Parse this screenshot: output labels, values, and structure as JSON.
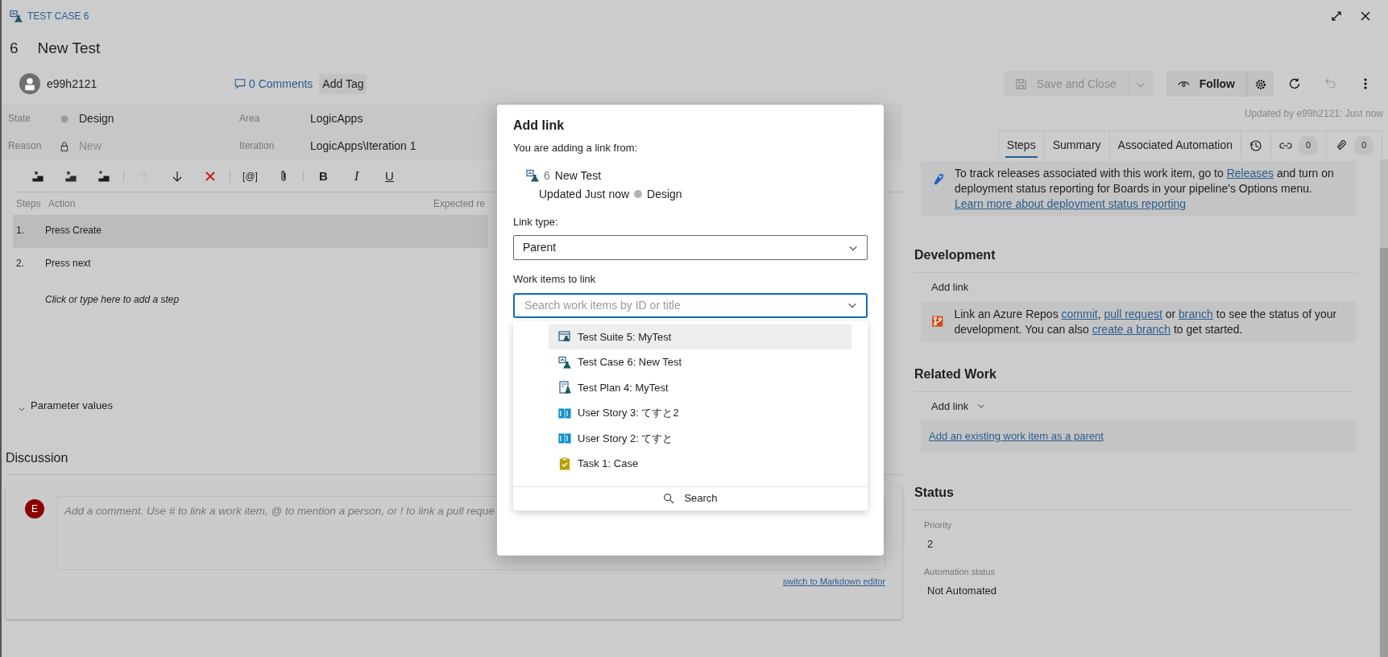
{
  "window": {
    "kind_label": "TEST CASE 6",
    "id": "6",
    "title": "New Test"
  },
  "header": {
    "assigned_to": "e99h2121",
    "comments": "0 Comments",
    "add_tag": "Add Tag",
    "updated": "Updated by e99h2121: Just now"
  },
  "toolbar": {
    "save": "Save and Close",
    "save_disabled": true,
    "follow": "Follow"
  },
  "fields": [
    {
      "label": "State",
      "value": "Design",
      "kind": "state"
    },
    {
      "label": "Area",
      "value": "LogicApps",
      "kind": "plain"
    },
    {
      "label": "Reason",
      "value": "New",
      "kind": "locked"
    },
    {
      "label": "Iteration",
      "value": "LogicApps\\Iteration 1",
      "kind": "plain"
    }
  ],
  "tabs": [
    {
      "label": "Steps",
      "selected": true
    },
    {
      "label": "Summary",
      "selected": false
    },
    {
      "label": "Associated Automation",
      "selected": false
    }
  ],
  "icon_tabs": [
    {
      "kind": "history"
    },
    {
      "kind": "links",
      "count": "0"
    },
    {
      "kind": "attachments",
      "count": "0"
    }
  ],
  "step_tools": [
    {
      "kind": "insert-step",
      "disabled": false
    },
    {
      "kind": "insert-shared",
      "disabled": false
    },
    {
      "kind": "create-shared",
      "disabled": false
    },
    {
      "kind": "separator"
    },
    {
      "kind": "move-up",
      "disabled": true
    },
    {
      "kind": "move-down",
      "disabled": false
    },
    {
      "kind": "delete",
      "disabled": false
    },
    {
      "kind": "separator"
    },
    {
      "kind": "mention",
      "label": "[@]",
      "disabled": false
    },
    {
      "kind": "attach",
      "disabled": false
    },
    {
      "kind": "separator"
    },
    {
      "kind": "bold",
      "label": "B",
      "disabled": false
    },
    {
      "kind": "italic",
      "label": "I",
      "disabled": false
    },
    {
      "kind": "underline",
      "label": "U",
      "disabled": false
    }
  ],
  "steps": {
    "columns": [
      "Steps",
      "Action",
      "Expected re"
    ],
    "rows": [
      {
        "number": "1.",
        "action": "Press Create",
        "selected": true
      },
      {
        "number": "2.",
        "action": "Press next",
        "selected": false
      }
    ],
    "add_hint": "Click or type here to add a step"
  },
  "parameters": {
    "label": "Parameter values",
    "expanded": true
  },
  "discussion": {
    "title": "Discussion",
    "avatar": "E",
    "placeholder": "Add a comment. Use # to link a work item, @ to mention a person, or ! to link a pull reque",
    "markdown_link": "switch to Markdown editor"
  },
  "deployment": {
    "parts": [
      {
        "kind": "text",
        "text": "To track releases associated with this work item, go to "
      },
      {
        "kind": "link",
        "text": "Releases"
      },
      {
        "kind": "text",
        "text": " and turn on deployment status reporting for Boards in your pipeline's Options menu."
      }
    ],
    "learn_more": "Learn more about deployment status reporting"
  },
  "development": {
    "title": "Development",
    "add_link": "Add link",
    "parts": [
      {
        "kind": "text",
        "text": "Link an Azure Repos "
      },
      {
        "kind": "link",
        "text": "commit"
      },
      {
        "kind": "text",
        "text": ", "
      },
      {
        "kind": "link",
        "text": "pull request"
      },
      {
        "kind": "text",
        "text": " or "
      },
      {
        "kind": "link",
        "text": "branch"
      },
      {
        "kind": "text",
        "text": " to see the status of your development. You can also "
      },
      {
        "kind": "link",
        "text": "create a branch"
      },
      {
        "kind": "text",
        "text": " to get started."
      }
    ]
  },
  "related_work": {
    "title": "Related Work",
    "add_link": "Add link",
    "parent_link": "Add an existing work item as a parent"
  },
  "status": {
    "title": "Status",
    "fields": [
      {
        "label": "Priority",
        "value": "2"
      },
      {
        "label": "Automation status",
        "value": "Not Automated"
      }
    ]
  },
  "dialog": {
    "title": "Add link",
    "intro": "You are adding a link from:",
    "source": {
      "id": "6",
      "title": "New Test",
      "updated": "Updated Just now",
      "state": "Design"
    },
    "link_type_label": "Link type:",
    "link_type": "Parent",
    "work_items_label": "Work items to link",
    "search_placeholder": "Search work items by ID or title",
    "results": [
      {
        "kind": "test-suite",
        "title": "Test Suite 5: MyTest",
        "selected": true
      },
      {
        "kind": "test-case",
        "title": "Test Case 6: New Test",
        "selected": false
      },
      {
        "kind": "test-plan",
        "title": "Test Plan 4: MyTest",
        "selected": false
      },
      {
        "kind": "user-story",
        "title": "User Story 3: てすと2",
        "selected": false
      },
      {
        "kind": "user-story",
        "title": "User Story 2: てすと",
        "selected": false
      },
      {
        "kind": "task",
        "title": "Task 1: Case",
        "selected": false
      }
    ],
    "search_button": "Search"
  }
}
